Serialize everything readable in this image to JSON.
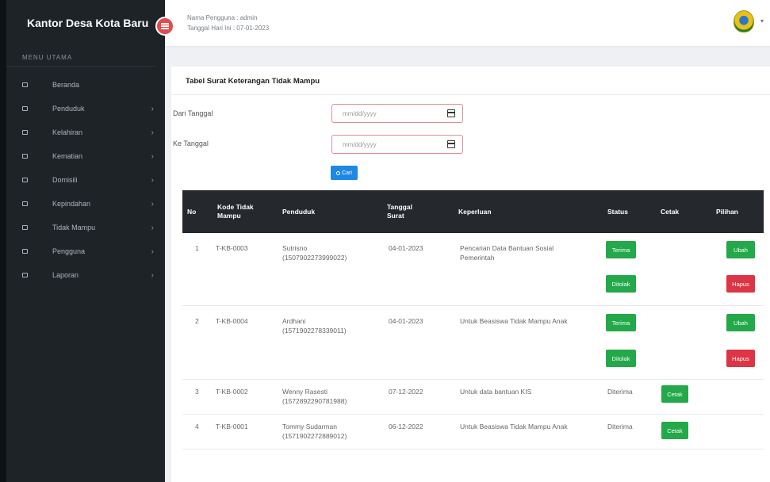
{
  "sidebar": {
    "brand": "Kantor Desa Kota Baru",
    "menu_header": "MENU UTAMA",
    "items": [
      {
        "label": "Beranda",
        "icon": "monitor-icon",
        "has_submenu": false
      },
      {
        "label": "Penduduk",
        "icon": "list-icon",
        "has_submenu": true
      },
      {
        "label": "Kelahiran",
        "icon": "list-icon",
        "has_submenu": true
      },
      {
        "label": "Kematian",
        "icon": "table-icon",
        "has_submenu": true
      },
      {
        "label": "Domisili",
        "icon": "document-icon",
        "has_submenu": true
      },
      {
        "label": "Kepindahan",
        "icon": "list-icon",
        "has_submenu": true
      },
      {
        "label": "Tidak Mampu",
        "icon": "list-icon",
        "has_submenu": true
      },
      {
        "label": "Pengguna",
        "icon": "users-icon",
        "has_submenu": true
      },
      {
        "label": "Laporan",
        "icon": "folder-icon",
        "has_submenu": true
      }
    ]
  },
  "topbar": {
    "user": "Nama Pengguna : admin",
    "date": "Tanggal Hari Ini : 07-01-2023"
  },
  "card": {
    "title": "Tabel Surat Keterangan Tidak Mampu",
    "from_label": "Dari Tanggal",
    "to_label": "Ke Tanggal",
    "date_placeholder": "mm/dd/yyyy",
    "search_label": "Cari"
  },
  "table": {
    "headers": {
      "no": "No",
      "kode": "Kode Tidak Mampu",
      "penduduk": "Penduduk",
      "tanggal": "Tanggal Surat",
      "keperluan": "Keperluan",
      "status": "Status",
      "cetak": "Cetak",
      "pilihan": "Pilihan"
    },
    "rows": [
      {
        "no": "1",
        "kode": "T-KB-0003",
        "nama": "Sutrisno",
        "nik": "(1507902273999022)",
        "tanggal": "04-01-2023",
        "keperluan": "Pencarian Data Bantuan Sosial Pemerintah"
      },
      {
        "no": "2",
        "kode": "T-KB-0004",
        "nama": "Ardhani",
        "nik": "(1571902278339011)",
        "tanggal": "04-01-2023",
        "keperluan": "Untuk Beasiswa Tidak Mampu Anak"
      },
      {
        "no": "3",
        "kode": "T-KB-0002",
        "nama": "Wenny Rasesti",
        "nik": "(1572892290781988)",
        "tanggal": "07-12-2022",
        "keperluan": "Untuk data bantuan KIS",
        "status": "Diterima"
      },
      {
        "no": "4",
        "kode": "T-KB-0001",
        "nama": "Tommy Sudarman",
        "nik": "(1571902272889012)",
        "tanggal": "06-12-2022",
        "keperluan": "Untuk Beasiswa Tidak Mampu Anak",
        "status": "Diterima"
      }
    ],
    "actions": {
      "terima": "Terima",
      "ditolak": "Ditolak",
      "ubah": "Ubah",
      "hapus": "Hapus",
      "cetak": "Cetak"
    }
  },
  "colors": {
    "sidebar": "#1d2327",
    "accent_green": "#23a84a",
    "accent_red": "#dc3545",
    "accent_blue": "#1e88e5"
  }
}
